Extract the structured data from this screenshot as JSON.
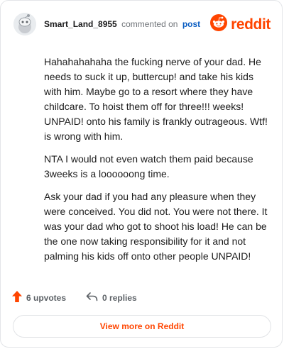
{
  "header": {
    "username": "Smart_Land_8955",
    "action_text": "commented on",
    "post_link": "post",
    "brand_name": "reddit"
  },
  "comment": {
    "paragraphs": [
      "Hahahahahaha the fucking nerve of your dad. He needs to suck it up, buttercup! and take his kids with him. Maybe go to a resort where they have childcare. To hoist them off for three!!! weeks! UNPAID! onto his family is frankly outrageous. Wtf! is wrong with him.",
      "NTA I would not even watch them paid because 3weeks is a loooooong time.",
      "Ask your dad if you had any pleasure when they were conceived. You did not. You were not there. It was your dad who got to shoot his load! He can be the one now taking responsibility for it and not palming his kids off onto other people UNPAID!"
    ]
  },
  "footer": {
    "upvotes": "6 upvotes",
    "replies": "0 replies",
    "view_more": "View more on Reddit"
  },
  "colors": {
    "brand": "#ff4500",
    "link": "#0a5dc2",
    "muted": "#5c6166"
  },
  "icons": {
    "avatar": "snoo-avatar-icon",
    "brand": "reddit-logo-icon",
    "upvote": "upvote-arrow-icon",
    "reply": "reply-arrow-icon"
  }
}
